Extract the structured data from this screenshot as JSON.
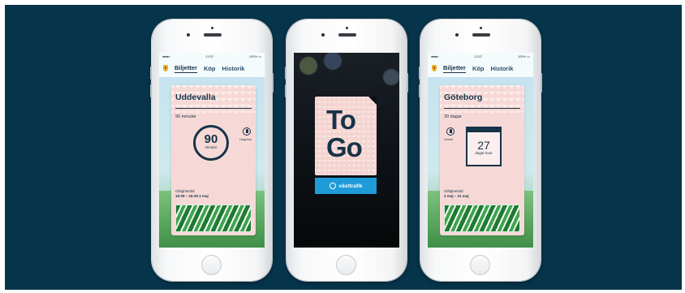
{
  "left_phone": {
    "status": {
      "signal": "●●●●○",
      "time": "13:37",
      "battery": "100% ▭"
    },
    "tabs": [
      "Biljetter",
      "Köp",
      "Historik"
    ],
    "ticket": {
      "city": "Uddevalla",
      "duration": "90 minuter",
      "number": "90",
      "unit": "minuter",
      "traveler_label": "Ungdom",
      "valid_label": "Giltighetstid",
      "valid_value": "15:09 – 16:39 2 maj"
    }
  },
  "center_phone": {
    "card_line1": "To",
    "card_line2": "Go",
    "brand": "västtrafik"
  },
  "right_phone": {
    "status": {
      "signal": "●●●●○",
      "time": "13:37",
      "battery": "100% ▭"
    },
    "tabs": [
      "Biljetter",
      "Köp",
      "Historik"
    ],
    "ticket": {
      "city": "Göteborg",
      "duration": "30 dagar",
      "number": "27",
      "unit": "dagar kvar",
      "traveler_label": "Vuxen",
      "valid_label": "Giltighetstid",
      "valid_value": "2 maj – 31 maj"
    }
  },
  "colors": {
    "background": "#06344a",
    "ticket_pink": "#f6d9d6",
    "navy": "#163348",
    "brand_blue": "#1f9bd8",
    "green": "#1f7a33"
  }
}
